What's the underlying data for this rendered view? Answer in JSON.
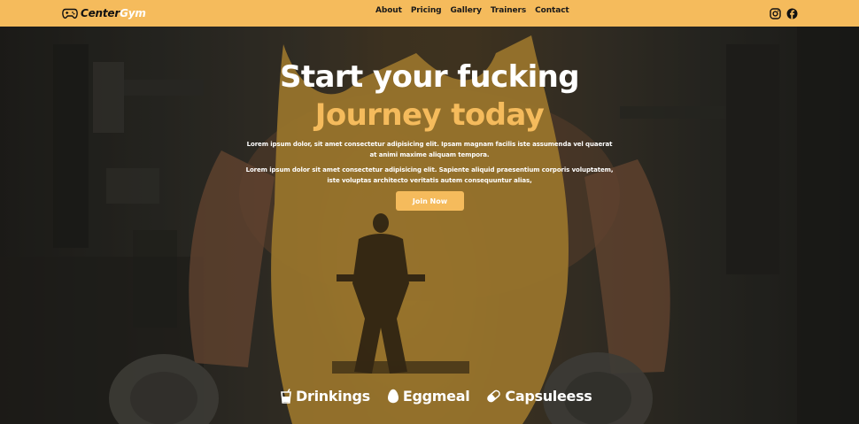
{
  "brand": {
    "name_dark": "Center",
    "name_light": "Gym"
  },
  "nav": {
    "items": [
      "About",
      "Pricing",
      "Gallery",
      "Trainers",
      "Contact"
    ]
  },
  "social": {
    "icons": [
      "instagram-icon",
      "facebook-icon"
    ]
  },
  "hero": {
    "title_line1": "Start your fucking",
    "title_line2": "Journey today",
    "paragraph1": "Lorem ipsum dolor, sit amet consectetur adipisicing elit. Ipsam magnam facilis iste assumenda vel quaerat at animi maxime aliquam tempora.",
    "paragraph2": "Lorem ipsum dolor sit amet consectetur adipisicing elit. Sapiente aliquid praesentium corporis voluptatem, iste voluptas architecto veritatis autem consequuntur alias,",
    "cta_label": "Join Now"
  },
  "features": [
    {
      "icon": "cup-icon",
      "label": "Drinkings"
    },
    {
      "icon": "egg-icon",
      "label": "Eggmeal"
    },
    {
      "icon": "capsule-icon",
      "label": "Capsuleess"
    }
  ],
  "colors": {
    "accent": "#f5bb5c",
    "text_light": "#ffffff",
    "text_dark": "#111111"
  }
}
